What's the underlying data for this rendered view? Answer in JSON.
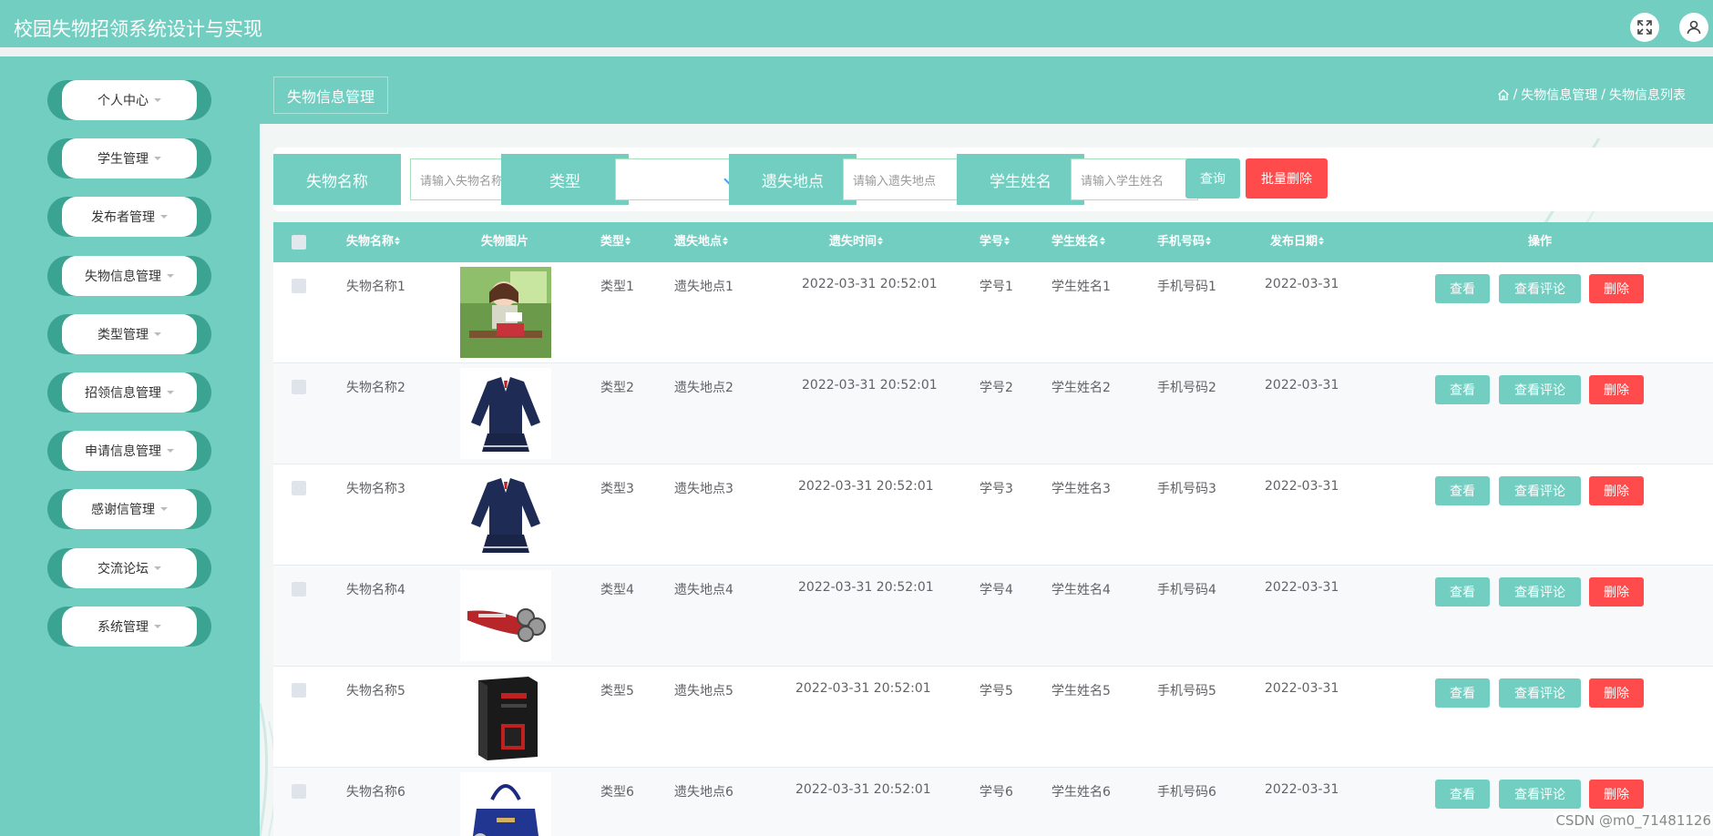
{
  "app": {
    "title": "校园失物招领系统设计与实现"
  },
  "colors": {
    "primary": "#71cec1",
    "danger": "#ff4b4b",
    "sidebar_ring": "#3aa392"
  },
  "sidebar": {
    "items": [
      {
        "label": "个人中心"
      },
      {
        "label": "学生管理"
      },
      {
        "label": "发布者管理"
      },
      {
        "label": "失物信息管理"
      },
      {
        "label": "类型管理"
      },
      {
        "label": "招领信息管理"
      },
      {
        "label": "申请信息管理"
      },
      {
        "label": "感谢信管理"
      },
      {
        "label": "交流论坛"
      },
      {
        "label": "系统管理"
      }
    ]
  },
  "header": {
    "page_title": "失物信息管理",
    "breadcrumb": [
      "失物信息管理",
      "失物信息列表"
    ]
  },
  "search": {
    "name_label": "失物名称",
    "name_placeholder": "请输入失物名称",
    "type_label": "类型",
    "type_value": "",
    "place_label": "遗失地点",
    "place_placeholder": "请输入遗失地点",
    "student_label": "学生姓名",
    "student_placeholder": "请输入学生姓名",
    "query_btn": "查询",
    "batch_delete_btn": "批量删除"
  },
  "table": {
    "columns": [
      "失物名称",
      "失物图片",
      "类型",
      "遗失地点",
      "遗失时间",
      "学号",
      "学生姓名",
      "手机号码",
      "发布日期",
      "操作"
    ],
    "actions": {
      "view": "查看",
      "comments": "查看评论",
      "delete": "删除"
    },
    "rows": [
      {
        "name": "失物名称1",
        "image": "anime-girl-reading",
        "type": "类型1",
        "place": "遗失地点1",
        "time": "2022-03-31 20:52:01",
        "student_id": "学号1",
        "student_name": "学生姓名1",
        "phone": "手机号码1",
        "date": "2022-03-31"
      },
      {
        "name": "失物名称2",
        "image": "school-uniform",
        "type": "类型2",
        "place": "遗失地点2",
        "time": "2022-03-31 20:52:01",
        "student_id": "学号2",
        "student_name": "学生姓名2",
        "phone": "手机号码2",
        "date": "2022-03-31"
      },
      {
        "name": "失物名称3",
        "image": "school-uniform",
        "type": "类型3",
        "place": "遗失地点3",
        "time": "2022-03-31 20:52:01",
        "student_id": "学号3",
        "student_name": "学生姓名3",
        "phone": "手机号码3",
        "date": "2022-03-31"
      },
      {
        "name": "失物名称4",
        "image": "electric-shaver",
        "type": "类型4",
        "place": "遗失地点4",
        "time": "2022-03-31 20:52:01",
        "student_id": "学号4",
        "student_name": "学生姓名4",
        "phone": "手机号码4",
        "date": "2022-03-31"
      },
      {
        "name": "失物名称5",
        "image": "pc-case",
        "type": "类型5",
        "place": "遗失地点5",
        "time": "2022-03-31 20:52:01",
        "student_id": "学号5",
        "student_name": "学生姓名5",
        "phone": "手机号码5",
        "date": "2022-03-31"
      },
      {
        "name": "失物名称6",
        "image": "handbag",
        "type": "类型6",
        "place": "遗失地点6",
        "time": "2022-03-31 20:52:01",
        "student_id": "学号6",
        "student_name": "学生姓名6",
        "phone": "手机号码6",
        "date": "2022-03-31"
      }
    ]
  },
  "watermark": "CSDN @m0_71481126"
}
